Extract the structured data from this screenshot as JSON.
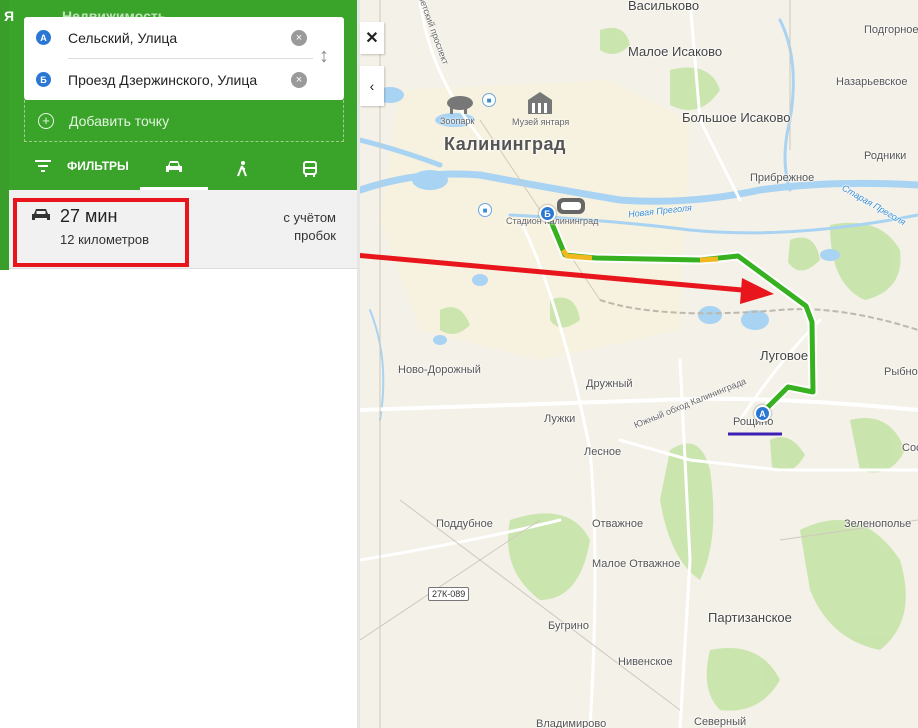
{
  "header": {
    "logo": "Я",
    "title": "Недвижимость"
  },
  "route": {
    "from": {
      "letter": "А",
      "address": "Сельский, Улица"
    },
    "to": {
      "letter": "Б",
      "address": "Проезд Дзержинского, Улица"
    },
    "add_point_label": "Добавить точку"
  },
  "modes": {
    "filters_label": "ФИЛЬТРЫ",
    "items": [
      "car-icon",
      "walk-icon",
      "bus-icon"
    ],
    "active": "car-icon"
  },
  "result": {
    "time": "27 мин",
    "distance": "12 километров",
    "traffic_line1": "с учётом",
    "traffic_line2": "пробок"
  },
  "map": {
    "city": "Калининград",
    "places": [
      "Васильково",
      "Подгорное",
      "Малое Исаково",
      "Большое Исаково",
      "Назарьевское",
      "Родники",
      "Прибрежное",
      "Луговое",
      "Рыбное",
      "Ново-Дорожный",
      "Дружный",
      "Рощино",
      "Лужки",
      "Лесное",
      "Сос",
      "Поддубное",
      "Отважное",
      "Зеленополье",
      "Малое Отважное",
      "Партизанское",
      "Бугрино",
      "Нивенское",
      "Северный",
      "Владимирово"
    ],
    "pois": [
      "Зоопарк",
      "Музей янтаря",
      "Стадион Калининград"
    ],
    "river_labels": [
      "Новая Преголя",
      "Старая Преголя"
    ],
    "road_labels": [
      "Южный обход Калининграда",
      "Советский проспект"
    ],
    "road_badge": "27К-089",
    "pin_a": "A",
    "pin_b": "Б"
  },
  "colors": {
    "panel_green": "#3aa329",
    "route_green": "#37b11f",
    "route_yellow": "#f1b91f",
    "annotation_red": "#e8161c",
    "pin_blue": "#2b78d4"
  }
}
